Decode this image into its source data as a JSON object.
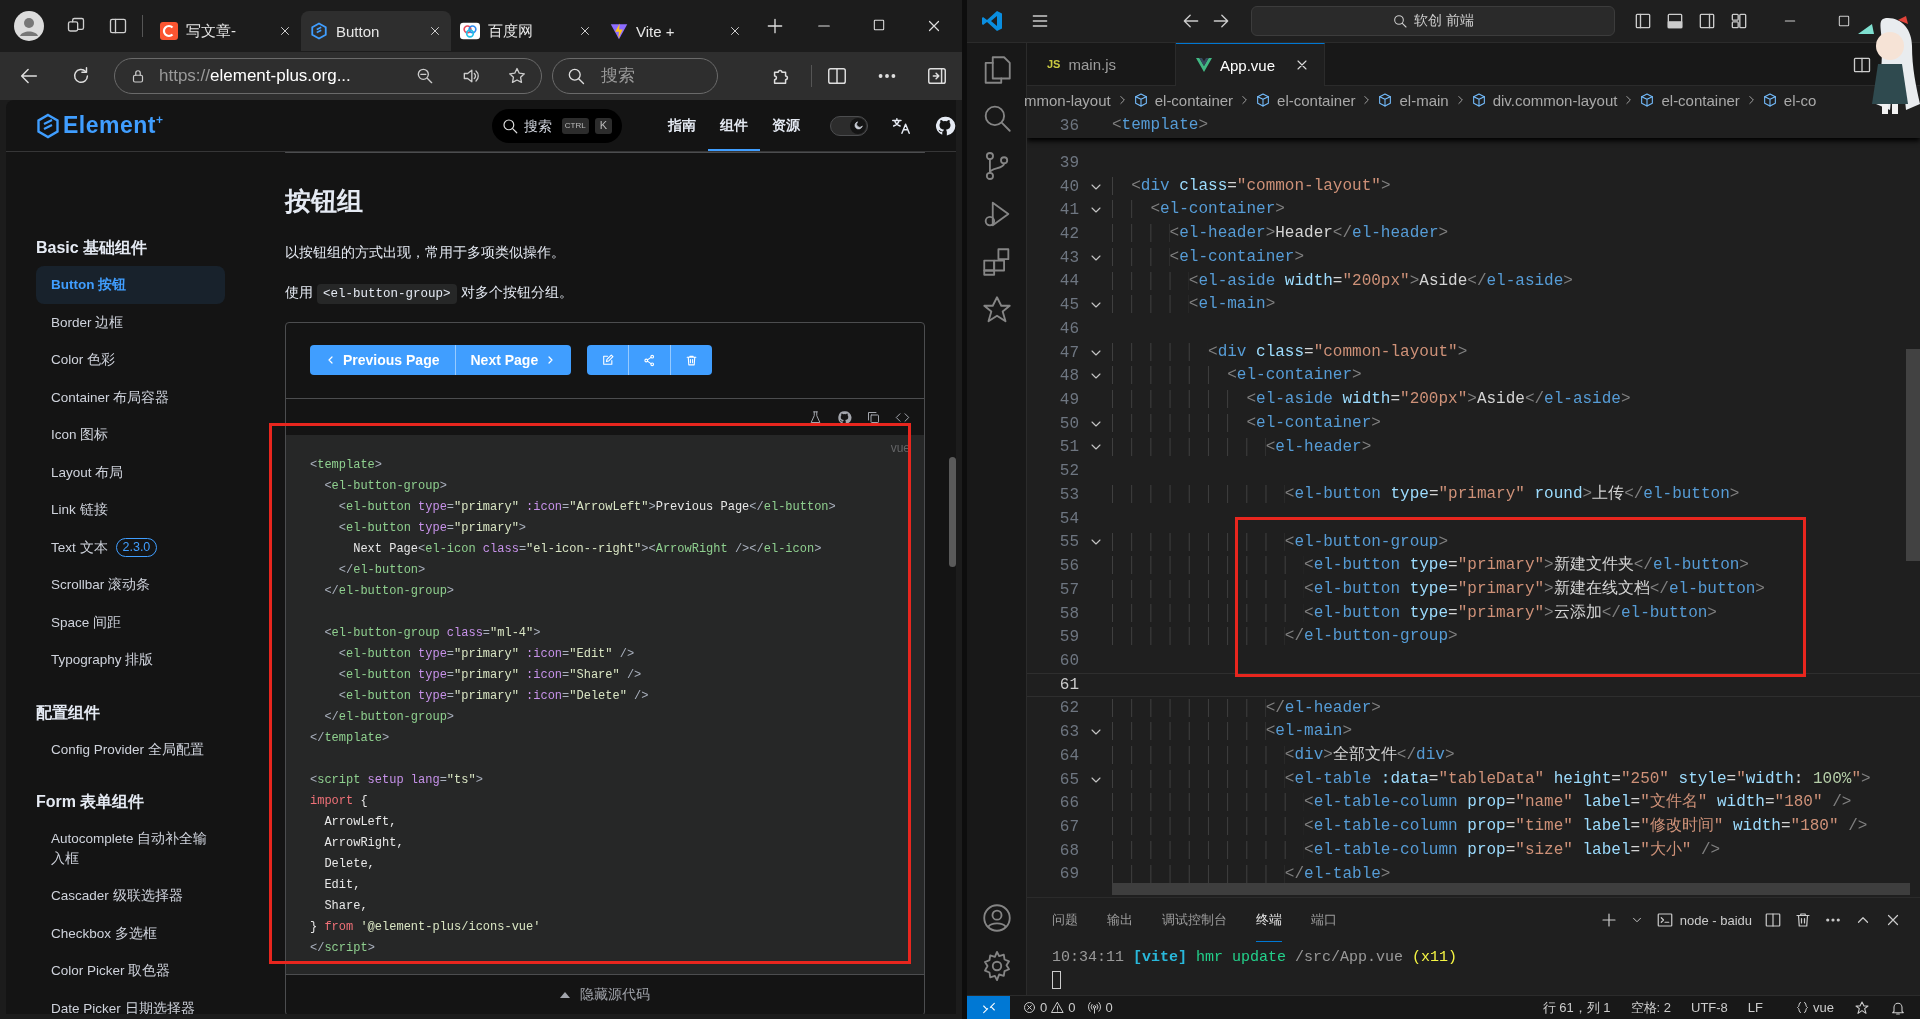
{
  "browser": {
    "tabs": [
      {
        "label": "写文章-",
        "selected": false
      },
      {
        "label": "Button",
        "selected": true
      },
      {
        "label": "百度网",
        "selected": false
      },
      {
        "label": "Vite +",
        "selected": false
      }
    ],
    "address": {
      "scheme": "https://",
      "rest": "element-plus.org..."
    },
    "search": {
      "placeholder": "搜索"
    }
  },
  "site": {
    "logo": {
      "name": "Element",
      "mark": "+"
    },
    "search": {
      "placeholder": "搜索",
      "keys": [
        "CTRL",
        "K"
      ]
    },
    "nav": [
      {
        "label": "指南",
        "selected": false
      },
      {
        "label": "组件",
        "selected": true
      },
      {
        "label": "资源",
        "selected": false
      }
    ],
    "theme_toggle": {
      "on": true
    }
  },
  "sidebar": {
    "groups": [
      {
        "title": "Basic 基础组件",
        "items": [
          {
            "label": "Button 按钮",
            "selected": true
          },
          {
            "label": "Border 边框",
            "selected": false
          },
          {
            "label": "Color 色彩",
            "selected": false
          },
          {
            "label": "Container 布局容器",
            "selected": false
          },
          {
            "label": "Icon 图标",
            "selected": false
          },
          {
            "label": "Layout 布局",
            "selected": false
          },
          {
            "label": "Link 链接",
            "selected": false
          },
          {
            "label": "Text 文本",
            "badge": "2.3.0",
            "selected": false
          },
          {
            "label": "Scrollbar 滚动条",
            "selected": false
          },
          {
            "label": "Space 间距",
            "selected": false
          },
          {
            "label": "Typography 排版",
            "selected": false
          }
        ]
      },
      {
        "title": "配置组件",
        "items": [
          {
            "label": "Config Provider 全局配置",
            "selected": false
          }
        ]
      },
      {
        "title": "Form 表单组件",
        "items": [
          {
            "label": "Autocomplete 自动补全输入框",
            "selected": false
          },
          {
            "label": "Cascader 级联选择器",
            "selected": false
          },
          {
            "label": "Checkbox 多选框",
            "selected": false
          },
          {
            "label": "Color Picker 取色器",
            "selected": false
          },
          {
            "label": "Date Picker 日期选择器",
            "selected": false
          }
        ]
      }
    ]
  },
  "doc": {
    "title": "按钮组",
    "intro": "以按钮组的方式出现，常用于多项类似操作。",
    "usage": {
      "before": "使用",
      "code": "<el-button-group>",
      "after": "对多个按钮分组。"
    },
    "demo": {
      "nav_buttons": [
        {
          "label": "Previous Page",
          "icon_before": true
        },
        {
          "label": "Next Page",
          "icon_before": false
        }
      ],
      "code": {
        "language": "vue",
        "lines": [
          {
            "kind": "code",
            "tokens": [
              {
                "kind": "punct",
                "text": "<"
              },
              {
                "kind": "tag",
                "text": "template"
              },
              {
                "kind": "punct",
                "text": ">"
              }
            ]
          },
          {
            "kind": "code",
            "tokens": [
              {
                "kind": "punct",
                "text": "  <"
              },
              {
                "kind": "tag",
                "text": "el-button-group"
              },
              {
                "kind": "punct",
                "text": ">"
              }
            ]
          },
          {
            "kind": "code",
            "tokens": [
              {
                "kind": "punct",
                "text": "    <"
              },
              {
                "kind": "tag",
                "text": "el-button"
              },
              {
                "kind": "attr",
                "text": " type"
              },
              {
                "kind": "punct",
                "text": "="
              },
              {
                "kind": "string",
                "text": "\"primary\""
              },
              {
                "kind": "attr",
                "text": " :icon"
              },
              {
                "kind": "punct",
                "text": "="
              },
              {
                "kind": "string",
                "text": "\"ArrowLeft\""
              },
              {
                "kind": "punct",
                "text": ">"
              },
              {
                "kind": "text",
                "text": "Previous Page"
              },
              {
                "kind": "punct",
                "text": "</"
              },
              {
                "kind": "tag",
                "text": "el-button"
              },
              {
                "kind": "punct",
                "text": ">"
              }
            ]
          },
          {
            "kind": "code",
            "tokens": [
              {
                "kind": "punct",
                "text": "    <"
              },
              {
                "kind": "tag",
                "text": "el-button"
              },
              {
                "kind": "attr",
                "text": " type"
              },
              {
                "kind": "punct",
                "text": "="
              },
              {
                "kind": "string",
                "text": "\"primary\""
              },
              {
                "kind": "punct",
                "text": ">"
              }
            ]
          },
          {
            "kind": "code",
            "tokens": [
              {
                "kind": "text",
                "text": "      Next Page"
              },
              {
                "kind": "punct",
                "text": "<"
              },
              {
                "kind": "tag",
                "text": "el-icon"
              },
              {
                "kind": "attr",
                "text": " class"
              },
              {
                "kind": "punct",
                "text": "="
              },
              {
                "kind": "string",
                "text": "\"el-icon--right\""
              },
              {
                "kind": "punct",
                "text": "><"
              },
              {
                "kind": "tag",
                "text": "ArrowRight"
              },
              {
                "kind": "punct",
                "text": " /></"
              },
              {
                "kind": "tag",
                "text": "el-icon"
              },
              {
                "kind": "punct",
                "text": ">"
              }
            ]
          },
          {
            "kind": "code",
            "tokens": [
              {
                "kind": "punct",
                "text": "    </"
              },
              {
                "kind": "tag",
                "text": "el-button"
              },
              {
                "kind": "punct",
                "text": ">"
              }
            ]
          },
          {
            "kind": "code",
            "tokens": [
              {
                "kind": "punct",
                "text": "  </"
              },
              {
                "kind": "tag",
                "text": "el-button-group"
              },
              {
                "kind": "punct",
                "text": ">"
              }
            ]
          },
          {
            "kind": "blank"
          },
          {
            "kind": "code",
            "tokens": [
              {
                "kind": "punct",
                "text": "  <"
              },
              {
                "kind": "tag",
                "text": "el-button-group"
              },
              {
                "kind": "attr",
                "text": " class"
              },
              {
                "kind": "punct",
                "text": "="
              },
              {
                "kind": "string",
                "text": "\"ml-4\""
              },
              {
                "kind": "punct",
                "text": ">"
              }
            ]
          },
          {
            "kind": "code",
            "tokens": [
              {
                "kind": "punct",
                "text": "    <"
              },
              {
                "kind": "tag",
                "text": "el-button"
              },
              {
                "kind": "attr",
                "text": " type"
              },
              {
                "kind": "punct",
                "text": "="
              },
              {
                "kind": "string",
                "text": "\"primary\""
              },
              {
                "kind": "attr",
                "text": " :icon"
              },
              {
                "kind": "punct",
                "text": "="
              },
              {
                "kind": "string",
                "text": "\"Edit\""
              },
              {
                "kind": "punct",
                "text": " />"
              }
            ]
          },
          {
            "kind": "code",
            "tokens": [
              {
                "kind": "punct",
                "text": "    <"
              },
              {
                "kind": "tag",
                "text": "el-button"
              },
              {
                "kind": "attr",
                "text": " type"
              },
              {
                "kind": "punct",
                "text": "="
              },
              {
                "kind": "string",
                "text": "\"primary\""
              },
              {
                "kind": "attr",
                "text": " :icon"
              },
              {
                "kind": "punct",
                "text": "="
              },
              {
                "kind": "string",
                "text": "\"Share\""
              },
              {
                "kind": "punct",
                "text": " />"
              }
            ]
          },
          {
            "kind": "code",
            "tokens": [
              {
                "kind": "punct",
                "text": "    <"
              },
              {
                "kind": "tag",
                "text": "el-button"
              },
              {
                "kind": "attr",
                "text": " type"
              },
              {
                "kind": "punct",
                "text": "="
              },
              {
                "kind": "string",
                "text": "\"primary\""
              },
              {
                "kind": "attr",
                "text": " :icon"
              },
              {
                "kind": "punct",
                "text": "="
              },
              {
                "kind": "string",
                "text": "\"Delete\""
              },
              {
                "kind": "punct",
                "text": " />"
              }
            ]
          },
          {
            "kind": "code",
            "tokens": [
              {
                "kind": "punct",
                "text": "  </"
              },
              {
                "kind": "tag",
                "text": "el-button-group"
              },
              {
                "kind": "punct",
                "text": ">"
              }
            ]
          },
          {
            "kind": "code",
            "tokens": [
              {
                "kind": "punct",
                "text": "</"
              },
              {
                "kind": "tag",
                "text": "template"
              },
              {
                "kind": "punct",
                "text": ">"
              }
            ]
          },
          {
            "kind": "blank"
          },
          {
            "kind": "code",
            "tokens": [
              {
                "kind": "punct",
                "text": "<"
              },
              {
                "kind": "tag",
                "text": "script"
              },
              {
                "kind": "attr",
                "text": " setup lang"
              },
              {
                "kind": "punct",
                "text": "="
              },
              {
                "kind": "string",
                "text": "\"ts\""
              },
              {
                "kind": "punct",
                "text": ">"
              }
            ]
          },
          {
            "kind": "code",
            "tokens": [
              {
                "kind": "keyword",
                "text": "import"
              },
              {
                "kind": "text",
                "text": " {"
              }
            ]
          },
          {
            "kind": "code",
            "tokens": [
              {
                "kind": "text",
                "text": "  ArrowLeft,"
              }
            ]
          },
          {
            "kind": "code",
            "tokens": [
              {
                "kind": "text",
                "text": "  ArrowRight,"
              }
            ]
          },
          {
            "kind": "code",
            "tokens": [
              {
                "kind": "text",
                "text": "  Delete,"
              }
            ]
          },
          {
            "kind": "code",
            "tokens": [
              {
                "kind": "text",
                "text": "  Edit,"
              }
            ]
          },
          {
            "kind": "code",
            "tokens": [
              {
                "kind": "text",
                "text": "  Share,"
              }
            ]
          },
          {
            "kind": "code",
            "tokens": [
              {
                "kind": "text",
                "text": "} "
              },
              {
                "kind": "keyword",
                "text": "from"
              },
              {
                "kind": "string",
                "text": " '@element-plus/icons-vue'"
              }
            ]
          },
          {
            "kind": "code",
            "tokens": [
              {
                "kind": "punct",
                "text": "</"
              },
              {
                "kind": "tag",
                "text": "script"
              },
              {
                "kind": "punct",
                "text": ">"
              }
            ]
          }
        ]
      },
      "toggle": "隐藏源代码"
    }
  },
  "editor": {
    "command_center": "软创 前端",
    "tabs": [
      {
        "label": "main.js",
        "icon_text": "JS",
        "selected": false
      },
      {
        "label": "App.vue",
        "selected": true
      }
    ],
    "breadcrumbs": [
      "mmon-layout",
      "el-container",
      "el-container",
      "el-main",
      "div.common-layout",
      "el-container",
      "el-co"
    ],
    "sticky": {
      "number": "36",
      "tokens": [
        {
          "kind": "punct",
          "text": "<"
        },
        {
          "kind": "tag",
          "text": "template"
        },
        {
          "kind": "punct",
          "text": ">"
        }
      ]
    },
    "lines": [
      {
        "number": "39",
        "foldable": false,
        "current": false,
        "kind": "blank"
      },
      {
        "number": "40",
        "foldable": true,
        "current": false,
        "kind": "code",
        "tokens": [
          {
            "kind": "punct",
            "text": "  <"
          },
          {
            "kind": "tag",
            "text": "div"
          },
          {
            "kind": "attr",
            "text": " class"
          },
          {
            "kind": "text",
            "text": "="
          },
          {
            "kind": "string",
            "text": "\"common-layout\""
          },
          {
            "kind": "punct",
            "text": ">"
          }
        ]
      },
      {
        "number": "41",
        "foldable": true,
        "current": false,
        "kind": "code",
        "tokens": [
          {
            "kind": "punct",
            "text": "    <"
          },
          {
            "kind": "tag",
            "text": "el-container"
          },
          {
            "kind": "punct",
            "text": ">"
          }
        ]
      },
      {
        "number": "42",
        "foldable": false,
        "current": false,
        "kind": "code",
        "tokens": [
          {
            "kind": "punct",
            "text": "      <"
          },
          {
            "kind": "tag",
            "text": "el-header"
          },
          {
            "kind": "punct",
            "text": ">"
          },
          {
            "kind": "text",
            "text": "Header"
          },
          {
            "kind": "punct",
            "text": "</"
          },
          {
            "kind": "tag",
            "text": "el-header"
          },
          {
            "kind": "punct",
            "text": ">"
          }
        ]
      },
      {
        "number": "43",
        "foldable": true,
        "current": false,
        "kind": "code",
        "tokens": [
          {
            "kind": "punct",
            "text": "      <"
          },
          {
            "kind": "tag",
            "text": "el-container"
          },
          {
            "kind": "punct",
            "text": ">"
          }
        ]
      },
      {
        "number": "44",
        "foldable": false,
        "current": false,
        "kind": "code",
        "tokens": [
          {
            "kind": "punct",
            "text": "        <"
          },
          {
            "kind": "tag",
            "text": "el-aside"
          },
          {
            "kind": "attr",
            "text": " width"
          },
          {
            "kind": "text",
            "text": "="
          },
          {
            "kind": "string",
            "text": "\"200px\""
          },
          {
            "kind": "punct",
            "text": ">"
          },
          {
            "kind": "text",
            "text": "Aside"
          },
          {
            "kind": "punct",
            "text": "</"
          },
          {
            "kind": "tag",
            "text": "el-aside"
          },
          {
            "kind": "punct",
            "text": ">"
          }
        ]
      },
      {
        "number": "45",
        "foldable": true,
        "current": false,
        "kind": "code",
        "tokens": [
          {
            "kind": "punct",
            "text": "        <"
          },
          {
            "kind": "tag",
            "text": "el-main"
          },
          {
            "kind": "punct",
            "text": ">"
          }
        ]
      },
      {
        "number": "46",
        "foldable": false,
        "current": false,
        "kind": "blank"
      },
      {
        "number": "47",
        "foldable": true,
        "current": false,
        "kind": "code",
        "tokens": [
          {
            "kind": "punct",
            "text": "          <"
          },
          {
            "kind": "tag",
            "text": "div"
          },
          {
            "kind": "attr",
            "text": " class"
          },
          {
            "kind": "text",
            "text": "="
          },
          {
            "kind": "string",
            "text": "\"common-layout\""
          },
          {
            "kind": "punct",
            "text": ">"
          }
        ]
      },
      {
        "number": "48",
        "foldable": true,
        "current": false,
        "kind": "code",
        "tokens": [
          {
            "kind": "punct",
            "text": "            <"
          },
          {
            "kind": "tag",
            "text": "el-container"
          },
          {
            "kind": "punct",
            "text": ">"
          }
        ]
      },
      {
        "number": "49",
        "foldable": false,
        "current": false,
        "kind": "code",
        "tokens": [
          {
            "kind": "punct",
            "text": "              <"
          },
          {
            "kind": "tag",
            "text": "el-aside"
          },
          {
            "kind": "attr",
            "text": " width"
          },
          {
            "kind": "text",
            "text": "="
          },
          {
            "kind": "string",
            "text": "\"200px\""
          },
          {
            "kind": "punct",
            "text": ">"
          },
          {
            "kind": "text",
            "text": "Aside"
          },
          {
            "kind": "punct",
            "text": "</"
          },
          {
            "kind": "tag",
            "text": "el-aside"
          },
          {
            "kind": "punct",
            "text": ">"
          }
        ]
      },
      {
        "number": "50",
        "foldable": true,
        "current": false,
        "kind": "code",
        "tokens": [
          {
            "kind": "punct",
            "text": "              <"
          },
          {
            "kind": "tag",
            "text": "el-container"
          },
          {
            "kind": "punct",
            "text": ">"
          }
        ]
      },
      {
        "number": "51",
        "foldable": true,
        "current": false,
        "kind": "code",
        "tokens": [
          {
            "kind": "punct",
            "text": "                <"
          },
          {
            "kind": "tag",
            "text": "el-header"
          },
          {
            "kind": "punct",
            "text": ">"
          }
        ]
      },
      {
        "number": "52",
        "foldable": false,
        "current": false,
        "kind": "blank"
      },
      {
        "number": "53",
        "foldable": false,
        "current": false,
        "kind": "code",
        "tokens": [
          {
            "kind": "punct",
            "text": "                  <"
          },
          {
            "kind": "tag",
            "text": "el-button"
          },
          {
            "kind": "attr",
            "text": " type"
          },
          {
            "kind": "text",
            "text": "="
          },
          {
            "kind": "string",
            "text": "\"primary\""
          },
          {
            "kind": "attr",
            "text": " round"
          },
          {
            "kind": "punct",
            "text": ">"
          },
          {
            "kind": "text",
            "text": "上传"
          },
          {
            "kind": "punct",
            "text": "</"
          },
          {
            "kind": "tag",
            "text": "el-button"
          },
          {
            "kind": "punct",
            "text": ">"
          }
        ]
      },
      {
        "number": "54",
        "foldable": false,
        "current": false,
        "kind": "blank"
      },
      {
        "number": "55",
        "foldable": true,
        "current": false,
        "kind": "code",
        "tokens": [
          {
            "kind": "punct",
            "text": "                  <"
          },
          {
            "kind": "tag",
            "text": "el-button-group"
          },
          {
            "kind": "punct",
            "text": ">"
          }
        ]
      },
      {
        "number": "56",
        "foldable": false,
        "current": false,
        "kind": "code",
        "tokens": [
          {
            "kind": "punct",
            "text": "                    <"
          },
          {
            "kind": "tag",
            "text": "el-button"
          },
          {
            "kind": "attr",
            "text": " type"
          },
          {
            "kind": "text",
            "text": "="
          },
          {
            "kind": "string",
            "text": "\"primary\""
          },
          {
            "kind": "punct",
            "text": ">"
          },
          {
            "kind": "text",
            "text": "新建文件夹"
          },
          {
            "kind": "punct",
            "text": "</"
          },
          {
            "kind": "tag",
            "text": "el-button"
          },
          {
            "kind": "punct",
            "text": ">"
          }
        ]
      },
      {
        "number": "57",
        "foldable": false,
        "current": false,
        "kind": "code",
        "tokens": [
          {
            "kind": "punct",
            "text": "                    <"
          },
          {
            "kind": "tag",
            "text": "el-button"
          },
          {
            "kind": "attr",
            "text": " type"
          },
          {
            "kind": "text",
            "text": "="
          },
          {
            "kind": "string",
            "text": "\"primary\""
          },
          {
            "kind": "punct",
            "text": ">"
          },
          {
            "kind": "text",
            "text": "新建在线文档"
          },
          {
            "kind": "punct",
            "text": "</"
          },
          {
            "kind": "tag",
            "text": "el-button"
          },
          {
            "kind": "punct",
            "text": ">"
          }
        ]
      },
      {
        "number": "58",
        "foldable": false,
        "current": false,
        "kind": "code",
        "tokens": [
          {
            "kind": "punct",
            "text": "                    <"
          },
          {
            "kind": "tag",
            "text": "el-button"
          },
          {
            "kind": "attr",
            "text": " type"
          },
          {
            "kind": "text",
            "text": "="
          },
          {
            "kind": "string",
            "text": "\"primary\""
          },
          {
            "kind": "punct",
            "text": ">"
          },
          {
            "kind": "text",
            "text": "云添加"
          },
          {
            "kind": "punct",
            "text": "</"
          },
          {
            "kind": "tag",
            "text": "el-button"
          },
          {
            "kind": "punct",
            "text": ">"
          }
        ]
      },
      {
        "number": "59",
        "foldable": false,
        "current": false,
        "kind": "code",
        "tokens": [
          {
            "kind": "punct",
            "text": "                  </"
          },
          {
            "kind": "tag",
            "text": "el-button-group"
          },
          {
            "kind": "punct",
            "text": ">"
          }
        ]
      },
      {
        "number": "60",
        "foldable": false,
        "current": false,
        "kind": "blank"
      },
      {
        "number": "61",
        "foldable": false,
        "current": true,
        "kind": "blank"
      },
      {
        "number": "62",
        "foldable": false,
        "current": false,
        "kind": "code",
        "tokens": [
          {
            "kind": "punct",
            "text": "                </"
          },
          {
            "kind": "tag",
            "text": "el-header"
          },
          {
            "kind": "punct",
            "text": ">"
          }
        ]
      },
      {
        "number": "63",
        "foldable": true,
        "current": false,
        "kind": "code",
        "tokens": [
          {
            "kind": "punct",
            "text": "                <"
          },
          {
            "kind": "tag",
            "text": "el-main"
          },
          {
            "kind": "punct",
            "text": ">"
          }
        ]
      },
      {
        "number": "64",
        "foldable": false,
        "current": false,
        "kind": "code",
        "tokens": [
          {
            "kind": "punct",
            "text": "                  <"
          },
          {
            "kind": "tag",
            "text": "div"
          },
          {
            "kind": "punct",
            "text": ">"
          },
          {
            "kind": "text",
            "text": "全部文件"
          },
          {
            "kind": "punct",
            "text": "</"
          },
          {
            "kind": "tag",
            "text": "div"
          },
          {
            "kind": "punct",
            "text": ">"
          }
        ]
      },
      {
        "number": "65",
        "foldable": true,
        "current": false,
        "kind": "code",
        "tokens": [
          {
            "kind": "punct",
            "text": "                  <"
          },
          {
            "kind": "tag",
            "text": "el-table"
          },
          {
            "kind": "attr",
            "text": " :data"
          },
          {
            "kind": "text",
            "text": "="
          },
          {
            "kind": "string",
            "text": "\"tableData\""
          },
          {
            "kind": "attr",
            "text": " height"
          },
          {
            "kind": "text",
            "text": "="
          },
          {
            "kind": "string",
            "text": "\"250\""
          },
          {
            "kind": "attr",
            "text": " style"
          },
          {
            "kind": "text",
            "text": "="
          },
          {
            "kind": "string",
            "text": "\""
          },
          {
            "kind": "attr",
            "text": "width"
          },
          {
            "kind": "text",
            "text": ": "
          },
          {
            "kind": "number",
            "text": "100%"
          },
          {
            "kind": "string",
            "text": "\""
          },
          {
            "kind": "punct",
            "text": ">"
          }
        ]
      },
      {
        "number": "66",
        "foldable": false,
        "current": false,
        "kind": "code",
        "tokens": [
          {
            "kind": "punct",
            "text": "                    <"
          },
          {
            "kind": "tag",
            "text": "el-table-column"
          },
          {
            "kind": "attr",
            "text": " prop"
          },
          {
            "kind": "text",
            "text": "="
          },
          {
            "kind": "string",
            "text": "\"name\""
          },
          {
            "kind": "attr",
            "text": " label"
          },
          {
            "kind": "text",
            "text": "="
          },
          {
            "kind": "string",
            "text": "\"文件名\""
          },
          {
            "kind": "attr",
            "text": " width"
          },
          {
            "kind": "text",
            "text": "="
          },
          {
            "kind": "string",
            "text": "\"180\""
          },
          {
            "kind": "punct",
            "text": " />"
          }
        ]
      },
      {
        "number": "67",
        "foldable": false,
        "current": false,
        "kind": "code",
        "tokens": [
          {
            "kind": "punct",
            "text": "                    <"
          },
          {
            "kind": "tag",
            "text": "el-table-column"
          },
          {
            "kind": "attr",
            "text": " prop"
          },
          {
            "kind": "text",
            "text": "="
          },
          {
            "kind": "string",
            "text": "\"time\""
          },
          {
            "kind": "attr",
            "text": " label"
          },
          {
            "kind": "text",
            "text": "="
          },
          {
            "kind": "string",
            "text": "\"修改时间\""
          },
          {
            "kind": "attr",
            "text": " width"
          },
          {
            "kind": "text",
            "text": "="
          },
          {
            "kind": "string",
            "text": "\"180\""
          },
          {
            "kind": "punct",
            "text": " />"
          }
        ]
      },
      {
        "number": "68",
        "foldable": false,
        "current": false,
        "kind": "code",
        "tokens": [
          {
            "kind": "punct",
            "text": "                    <"
          },
          {
            "kind": "tag",
            "text": "el-table-column"
          },
          {
            "kind": "attr",
            "text": " prop"
          },
          {
            "kind": "text",
            "text": "="
          },
          {
            "kind": "string",
            "text": "\"size\""
          },
          {
            "kind": "attr",
            "text": " label"
          },
          {
            "kind": "text",
            "text": "="
          },
          {
            "kind": "string",
            "text": "\"大小\""
          },
          {
            "kind": "punct",
            "text": " />"
          }
        ]
      },
      {
        "number": "69",
        "foldable": false,
        "current": false,
        "kind": "code",
        "tokens": [
          {
            "kind": "punct",
            "text": "                  </"
          },
          {
            "kind": "tag",
            "text": "el-table"
          },
          {
            "kind": "punct",
            "text": ">"
          }
        ]
      }
    ],
    "panel": {
      "tabs": [
        {
          "label": "问题",
          "selected": false
        },
        {
          "label": "输出",
          "selected": false
        },
        {
          "label": "调试控制台",
          "selected": false
        },
        {
          "label": "终端",
          "selected": true
        },
        {
          "label": "端口",
          "selected": false
        }
      ],
      "terminal_name": "node - baidu",
      "output": [
        {
          "kind": "time",
          "text": "10:34:11 "
        },
        {
          "kind": "source",
          "text": "[vite]"
        },
        {
          "kind": "event",
          "text": " hmr update "
        },
        {
          "kind": "path",
          "text": "/src/App.vue "
        },
        {
          "kind": "count",
          "text": "(x11)"
        }
      ]
    },
    "status": {
      "errors": "0",
      "warnings": "0",
      "ports": "0",
      "position": "行 61，列 1",
      "indent": "空格: 2",
      "encoding": "UTF-8",
      "eol": "LF",
      "language": "vue"
    }
  }
}
